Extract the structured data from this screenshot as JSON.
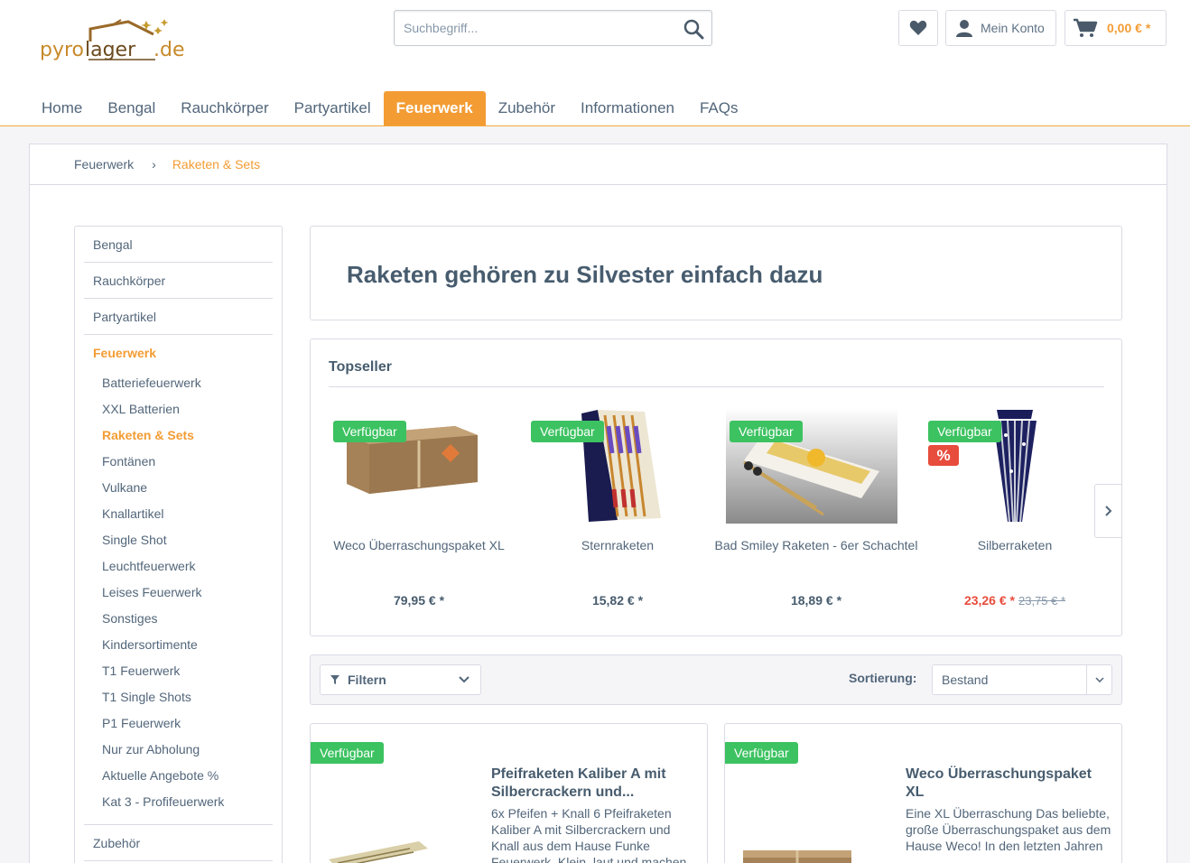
{
  "header": {
    "logo_text_dark": "pyro",
    "logo_text_accent": "lager",
    "logo_text_suffix": ".de",
    "search_placeholder": "Suchbegriff...",
    "account_label": "Mein Konto",
    "cart_total": "0,00 € *"
  },
  "nav": [
    {
      "label": "Home",
      "active": false
    },
    {
      "label": "Bengal",
      "active": false
    },
    {
      "label": "Rauchkörper",
      "active": false
    },
    {
      "label": "Partyartikel",
      "active": false
    },
    {
      "label": "Feuerwerk",
      "active": true
    },
    {
      "label": "Zubehör",
      "active": false
    },
    {
      "label": "Informationen",
      "active": false
    },
    {
      "label": "FAQs",
      "active": false
    }
  ],
  "breadcrumb": {
    "parent": "Feuerwerk",
    "current": "Raketen & Sets"
  },
  "sidebar": {
    "top": [
      "Bengal",
      "Rauchkörper",
      "Partyartikel"
    ],
    "active_category": "Feuerwerk",
    "subcategories": [
      "Batteriefeuerwerk",
      "XXL Batterien",
      "Raketen & Sets",
      "Fontänen",
      "Vulkane",
      "Knallartikel",
      "Single Shot",
      "Leuchtfeuerwerk",
      "Leises Feuerwerk",
      "Sonstiges",
      "Kindersortimente",
      "T1 Feuerwerk",
      "T1 Single Shots",
      "P1 Feuerwerk",
      "Nur zur Abholung",
      "Aktuelle Angebote %",
      "Kat 3 - Profifeuerwerk"
    ],
    "active_subcategory": "Raketen & Sets",
    "bottom": [
      "Zubehör"
    ]
  },
  "headline": "Raketen gehören zu Silvester einfach dazu",
  "topseller": {
    "title": "Topseller",
    "items": [
      {
        "name": "Weco Überraschungspaket XL",
        "price": "79,95 € *",
        "badge": "Verfügbar",
        "sale": false,
        "old_price": ""
      },
      {
        "name": "Sternraketen",
        "price": "15,82 € *",
        "badge": "Verfügbar",
        "sale": false,
        "old_price": ""
      },
      {
        "name": "Bad Smiley Raketen - 6er Schachtel",
        "price": "18,89 € *",
        "badge": "Verfügbar",
        "sale": false,
        "old_price": ""
      },
      {
        "name": "Silberraketen",
        "price": "23,26 € *",
        "badge": "Verfügbar",
        "sale": true,
        "sale_badge": "%",
        "old_price": "23,75 € *"
      }
    ]
  },
  "filterbar": {
    "filter_label": "Filtern",
    "sort_label": "Sortierung:",
    "sort_value": "Bestand"
  },
  "products": [
    {
      "badge": "Verfügbar",
      "title": "Pfeifraketen Kaliber A mit Silbercrackern und...",
      "description": "6x Pfeifen + Knall 6 Pfeifraketen Kaliber A mit Silbercrackern und Knall aus dem Hause Funke Feuerwerk. Klein, laut und machen"
    },
    {
      "badge": "Verfügbar",
      "title": "Weco Überraschungspaket XL",
      "description": "Eine XL Überraschung Das beliebte, große Überraschungspaket aus dem Hause Weco! In den letzten Jahren"
    }
  ],
  "colors": {
    "accent": "#f39c34",
    "available": "#3cc261",
    "sale": "#e74c3c",
    "text": "#52667a"
  }
}
